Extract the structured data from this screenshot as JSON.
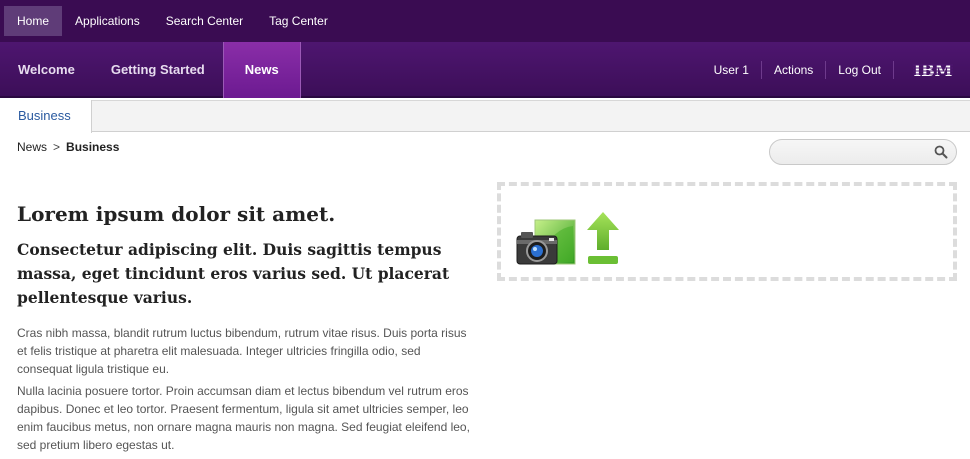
{
  "top_nav": {
    "items": [
      {
        "label": "Home",
        "active": true
      },
      {
        "label": "Applications"
      },
      {
        "label": "Search Center"
      },
      {
        "label": "Tag Center"
      }
    ]
  },
  "main_nav": {
    "items": [
      {
        "label": "Welcome"
      },
      {
        "label": "Getting Started"
      },
      {
        "label": "News",
        "active": true
      }
    ],
    "utility": {
      "user": "User 1",
      "actions": "Actions",
      "logout": "Log Out"
    },
    "logo_text": "IBM"
  },
  "sub_tabs": [
    {
      "label": "Business",
      "active": true
    }
  ],
  "breadcrumb": {
    "parent": "News",
    "separator": ">",
    "current": "Business"
  },
  "search": {
    "value": "",
    "icon": "search-icon"
  },
  "article": {
    "title": "Lorem ipsum dolor sit amet.",
    "subtitle": "Consectetur adipiscing elit. Duis sagittis tempus massa, eget tincidunt eros varius sed. Ut placerat pellentesque varius.",
    "paragraphs": [
      "Cras nibh massa, blandit rutrum luctus bibendum, rutrum vitae risus. Duis porta risus et felis tristique at pharetra elit malesuada. Integer ultricies fringilla odio, sed consequat ligula tristique eu.",
      "Nulla lacinia posuere tortor. Proin accumsan diam et lectus bibendum vel rutrum eros dapibus. Donec et leo tortor. Praesent fermentum, ligula sit amet ultricies semper, leo enim faucibus metus, non ornare magna mauris non magna. Sed feugiat eleifend leo, sed pretium libero egestas ut."
    ]
  },
  "upload_box": {
    "icons": [
      "camera-photo-icon",
      "upload-arrow-icon"
    ]
  },
  "colors": {
    "top_bar": "#3a0c52",
    "main_bar": "#4e1670",
    "active_tab": "#7a22a0",
    "link": "#2a5aa0",
    "upload_green": "#7ac943"
  }
}
